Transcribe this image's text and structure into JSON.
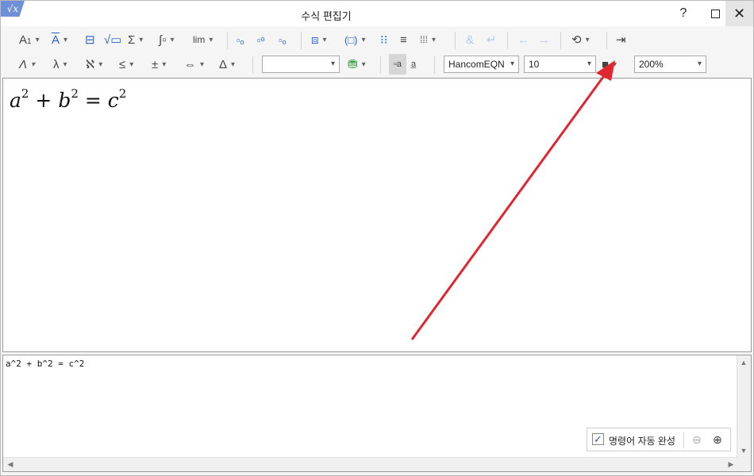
{
  "window": {
    "title": "수식 편집기",
    "app_icon": "√x",
    "help": "?"
  },
  "toolbar1": [
    {
      "name": "font-style-tool",
      "glyph": "A₁",
      "dropdown": true
    },
    {
      "name": "decoration-tool",
      "glyph": "A̅",
      "dropdown": true
    },
    {
      "name": "fraction-tool",
      "glyph": "⊟",
      "dropdown": false
    },
    {
      "name": "root-tool",
      "glyph": "√□",
      "dropdown": false
    },
    {
      "name": "sum-tool",
      "glyph": "Σ",
      "dropdown": true
    },
    {
      "name": "integral-tool",
      "glyph": "∫□",
      "dropdown": true
    },
    {
      "name": "limit-tool",
      "glyph": "lim",
      "dropdown": true
    },
    {
      "name": "subscript-tool",
      "glyph": "▫▫",
      "dropdown": false
    },
    {
      "name": "superscript-tool",
      "glyph": "▫▫",
      "dropdown": false
    },
    {
      "name": "sub-super-tool",
      "glyph": "▫▫",
      "dropdown": false
    },
    {
      "name": "stack-tool",
      "glyph": "⧈",
      "dropdown": true
    },
    {
      "name": "bracket-tool",
      "glyph": "(□)",
      "dropdown": true
    },
    {
      "name": "matrix-tool",
      "glyph": "⁝⁝",
      "dropdown": false
    },
    {
      "name": "lines-tool",
      "glyph": "≡",
      "dropdown": false
    },
    {
      "name": "grid-tool",
      "glyph": "⁞⁞⁞",
      "dropdown": true
    },
    {
      "name": "ampersand-tool",
      "glyph": "&",
      "dropdown": false
    },
    {
      "name": "newline-tool",
      "glyph": "↵",
      "dropdown": false
    },
    {
      "name": "undo-tool",
      "glyph": "←",
      "dropdown": false
    },
    {
      "name": "redo-tool",
      "glyph": "→",
      "dropdown": false
    },
    {
      "name": "convert-tool",
      "glyph": "⟲",
      "dropdown": true
    },
    {
      "name": "insert-tool",
      "glyph": "⇥",
      "dropdown": false
    }
  ],
  "toolbar2": [
    {
      "name": "greek-upper-tool",
      "glyph": "Λ",
      "dropdown": true
    },
    {
      "name": "greek-lower-tool",
      "glyph": "λ",
      "dropdown": true
    },
    {
      "name": "hebrew-tool",
      "glyph": "ℵ",
      "dropdown": true
    },
    {
      "name": "relation-tool",
      "glyph": "≤",
      "dropdown": true
    },
    {
      "name": "operator-tool",
      "glyph": "±",
      "dropdown": true
    },
    {
      "name": "arrow-tool",
      "glyph": "⇔",
      "dropdown": true
    },
    {
      "name": "delta-tool",
      "glyph": "Δ",
      "dropdown": true
    }
  ],
  "style_select": {
    "value": ""
  },
  "font_select": {
    "value": "HancomEQN"
  },
  "size_select": {
    "value": "10"
  },
  "zoom_select": {
    "value": "200%"
  },
  "equation": {
    "a": "a",
    "b": "b",
    "c": "c",
    "exp": "2",
    "plus": "+",
    "equals": "="
  },
  "script": {
    "text": "a^2 + b^2 = c^2"
  },
  "autocomplete": {
    "label": "명령어 자동 완성",
    "checked": true
  },
  "colors": {
    "accent": "#2a64c8",
    "annotation_arrow": "#e02630"
  }
}
